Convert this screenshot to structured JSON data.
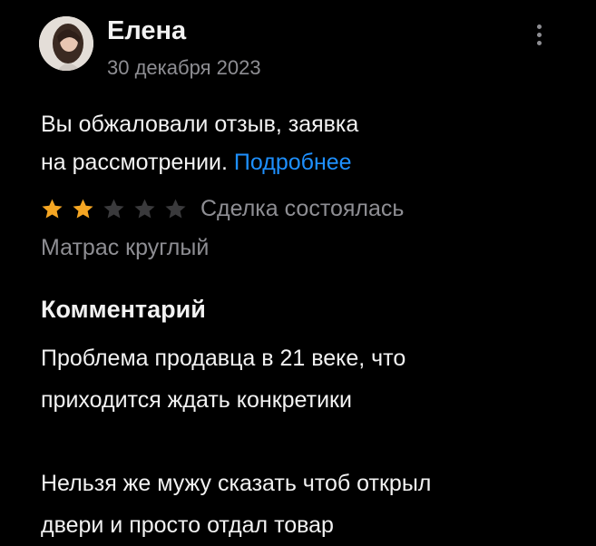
{
  "review": {
    "author_name": "Елена",
    "date": "30 декабря 2023",
    "more_icon": "vertical-ellipsis-icon",
    "appeal": {
      "line1": "Вы обжаловали отзыв, заявка",
      "line2": "на рассмотрении.",
      "link_label": "Подробнее"
    },
    "rating": {
      "value": 2,
      "max": 5,
      "filled_color": "#f5a623",
      "empty_color": "#3a3a3c"
    },
    "deal_status": "Сделка состоялась",
    "product_name": "Матрас круглый",
    "comment": {
      "heading": "Комментарий",
      "paragraph1_line1": "Проблема продавца в 21 веке, что",
      "paragraph1_line2": "приходится ждать конкретики",
      "paragraph2_line1": "Нельзя же мужу сказать чтоб открыл",
      "paragraph2_line2": "двери и просто отдал товар"
    }
  },
  "colors": {
    "background": "#000000",
    "text_primary": "#f2f2f2",
    "text_secondary": "#8e8e93",
    "link": "#1e90ff"
  }
}
